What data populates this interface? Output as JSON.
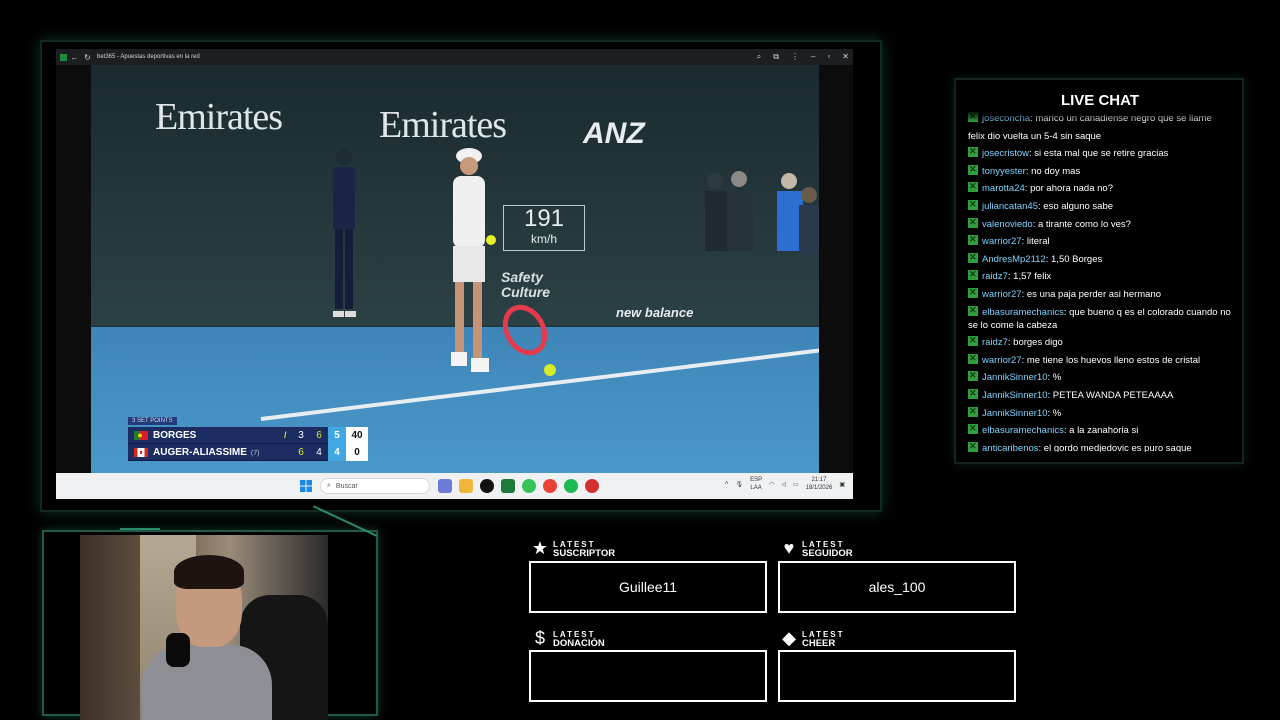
{
  "browser": {
    "tab_title": "bet365 - Apuestas deportivas en la red",
    "video": {
      "sponsor_1": "Emirates",
      "sponsor_2": "Emirates",
      "sponsor_3": "ANZ",
      "speed_value": "191",
      "speed_unit": "km/h",
      "safety_text_1": "Safety",
      "safety_text_2": "Culture",
      "nb_text": "new balance"
    },
    "scoreboard": {
      "header": "3 SET POINTS",
      "players": [
        {
          "name": "BORGES",
          "seed": "",
          "serving": true,
          "sets": [
            "3",
            "6"
          ],
          "current": "5",
          "points": "40"
        },
        {
          "name": "AUGER-ALIASSIME",
          "seed": "(7)",
          "serving": false,
          "sets": [
            "6",
            "4"
          ],
          "current": "4",
          "points": "0"
        }
      ]
    },
    "taskbar": {
      "search_placeholder": "Buscar",
      "lang_1": "ESP",
      "lang_2": "LAA",
      "time": "21:17",
      "date": "18/1/2026"
    }
  },
  "chat": {
    "title": "LIVE CHAT",
    "messages": [
      {
        "user": "joseconcha",
        "text": "marico un canadiense negro que se llame"
      },
      {
        "user": "",
        "text": "felix dio vuelta un 5-4 sin saque"
      },
      {
        "user": "josecristow",
        "text": "si esta mal que se retire gracias"
      },
      {
        "user": "tonyyester",
        "text": "no doy mas"
      },
      {
        "user": "marotta24",
        "text": "por ahora nada no?"
      },
      {
        "user": "juliancatan45",
        "text": "eso alguno sabe"
      },
      {
        "user": "valenoviedo",
        "text": "a tirante como lo ves?"
      },
      {
        "user": "warrior27",
        "text": "literal"
      },
      {
        "user": "AndresMp2112",
        "text": "1,50 Borges"
      },
      {
        "user": "raidz7",
        "text": "1,57 felix"
      },
      {
        "user": "warrior27",
        "text": "es una paja perder asi hermano"
      },
      {
        "user": "elbasuramechanics",
        "text": "que bueno q es el colorado cuando no se lo come la cabeza"
      },
      {
        "user": "raidz7",
        "text": "borges digo"
      },
      {
        "user": "warrior27",
        "text": "me tiene los huevos lleno estos de cristal"
      },
      {
        "user": "JannikSinner10",
        "text": "%"
      },
      {
        "user": "JannikSinner10",
        "text": "PETEA WANDA PETEAAAA"
      },
      {
        "user": "JannikSinner10",
        "text": "%"
      },
      {
        "user": "elbasuramechanics",
        "text": "a la zanahoria si"
      },
      {
        "user": "anticaribenos",
        "text": "el gordo medjedovic es puro saque"
      }
    ]
  },
  "alerts": {
    "subscriber": {
      "line1": "LATEST",
      "line2": "SUSCRIPTOR",
      "value": "Guillee11",
      "icon": "star-icon"
    },
    "follower": {
      "line1": "LATEST",
      "line2": "SEGUIDOR",
      "value": "ales_100",
      "icon": "heart-icon"
    },
    "donation": {
      "line1": "LATEST",
      "line2": "DONACIÓN",
      "value": "",
      "icon": "dollar-icon"
    },
    "cheer": {
      "line1": "LATEST",
      "line2": "CHEER",
      "value": "",
      "icon": "diamond-icon"
    }
  },
  "colors": {
    "accent_green": "#2a8a6a",
    "scoreboard_blue": "#1c2c63",
    "chat_username": "#7fd3ff"
  }
}
